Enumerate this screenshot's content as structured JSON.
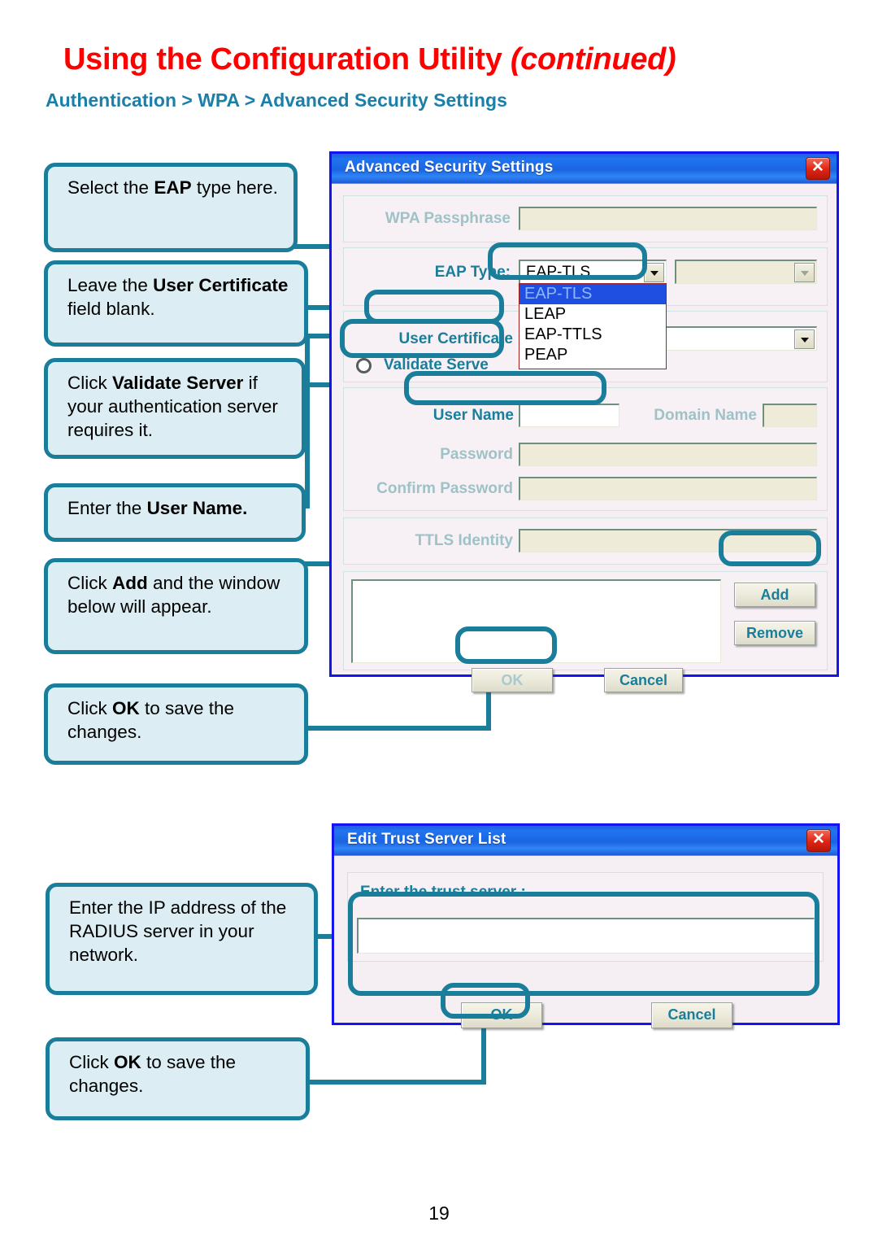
{
  "header": {
    "title_main": "Using the Configuration Utility ",
    "title_continued": "(continued)",
    "subtitle": "Authentication > WPA > Advanced Security Settings"
  },
  "footer": {
    "page_number": "19"
  },
  "callouts": [
    {
      "id": "eap-type",
      "text_html": "Select the <b>EAP</b> type here."
    },
    {
      "id": "user-cert",
      "text_html": "Leave the <b>User Certificate</b> field blank."
    },
    {
      "id": "validate",
      "text_html": "Click <b>Validate Server</b> if your authentication server requires it."
    },
    {
      "id": "user-name",
      "text_html": "Enter the <b>User Name.</b>"
    },
    {
      "id": "add",
      "text_html": "Click <b>Add</b> and the window below will appear."
    },
    {
      "id": "ok-1",
      "text_html": "Click <b>OK</b> to save the changes."
    },
    {
      "id": "ip-address",
      "text_html": "Enter the IP address of the RADIUS server in your network."
    },
    {
      "id": "ok-2",
      "text_html": "Click <b>OK</b> to save the changes."
    }
  ],
  "dialog_advanced": {
    "title": "Advanced Security Settings",
    "close_label": "✕",
    "fields": {
      "wpa_passphrase_label": "WPA Passphrase",
      "wpa_passphrase_value": "",
      "eap_type_label": "EAP Type:",
      "eap_type_value": "EAP-TLS",
      "user_certificate_label": "User Certificate",
      "user_certificate_value": "",
      "validate_server_label": "Validate Serve",
      "user_name_label": "User Name",
      "user_name_value": "",
      "domain_name_label": "Domain Name",
      "domain_name_value": "",
      "password_label": "Password",
      "password_value": "",
      "confirm_password_label": "Confirm Password",
      "confirm_password_value": "",
      "ttls_identity_label": "TTLS Identity",
      "ttls_identity_value": "",
      "trust_list_value": ""
    },
    "eap_type_options": [
      "EAP-TLS",
      "LEAP",
      "EAP-TTLS",
      "PEAP"
    ],
    "eap_type_selected_index": 0,
    "buttons": {
      "add": "Add",
      "remove": "Remove",
      "ok": "OK",
      "cancel": "Cancel"
    }
  },
  "dialog_trust": {
    "title": "Edit Trust Server List",
    "close_label": "✕",
    "prompt": "Enter the trust server :",
    "input_value": "",
    "buttons": {
      "ok": "OK",
      "cancel": "Cancel"
    }
  },
  "colors": {
    "title_red": "#fe0000",
    "subtitle_blue": "#1b7fa8",
    "callout_border": "#1a7e9b",
    "callout_fill": "#dceef4",
    "dialog_border": "#1414f0",
    "titlebar_blue": "#1f64e2",
    "close_red": "#e02413"
  },
  "icons": {
    "close": "close-icon",
    "dropdown_arrow": "chevron-down-icon",
    "radio": "radio-button-icon"
  }
}
